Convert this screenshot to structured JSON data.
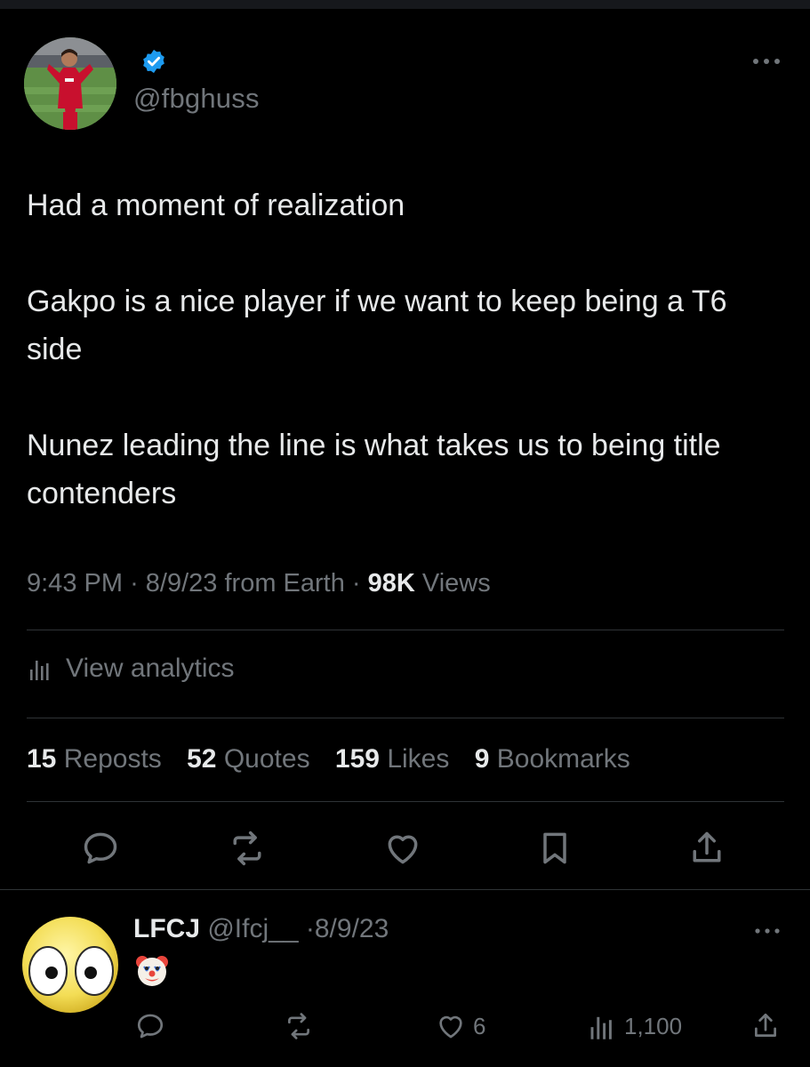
{
  "tweet": {
    "handle": "@fbghuss",
    "paragraphs": [
      "Had a moment of realization",
      "Gakpo is a nice player if we want to keep being a T6 side",
      "Nunez leading the line is what takes us to being title contenders"
    ],
    "time": "9:43 PM",
    "date": "8/9/23",
    "source": "from Earth",
    "views_count": "98K",
    "views_label": "Views",
    "analytics_label": "View analytics",
    "stats": {
      "reposts_count": "15",
      "reposts_label": "Reposts",
      "quotes_count": "52",
      "quotes_label": "Quotes",
      "likes_count": "159",
      "likes_label": "Likes",
      "bookmarks_count": "9",
      "bookmarks_label": "Bookmarks"
    }
  },
  "reply": {
    "name": "LFCJ",
    "handle": "@Ifcj__",
    "date": "8/9/23",
    "content_emoji": "clown-face",
    "likes": "6",
    "views": "1,100"
  },
  "icons": [
    "verified-badge-icon",
    "more-icon",
    "reply-icon",
    "repost-icon",
    "like-icon",
    "bookmark-icon",
    "share-icon",
    "analytics-icon"
  ],
  "colors": {
    "background": "#000000",
    "primary_text": "#e7e9ea",
    "secondary_text": "#71767b",
    "verified_blue": "#1d9bf0",
    "divider": "#2f3336"
  }
}
